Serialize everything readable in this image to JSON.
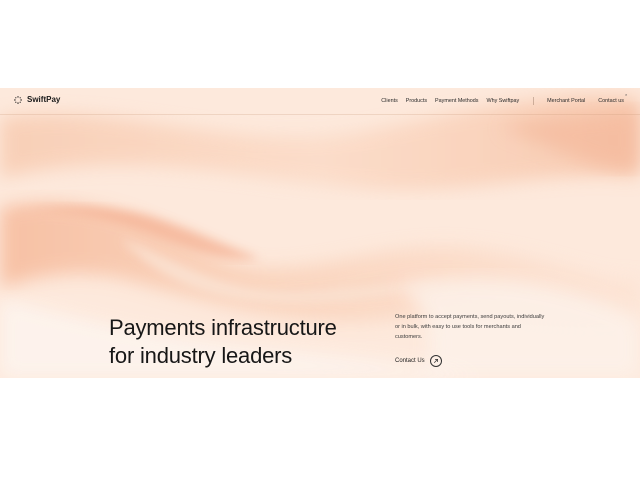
{
  "brand": {
    "name": "SwiftPay",
    "logo_icon": "dotted-burst-icon"
  },
  "nav": {
    "links": [
      "Clients",
      "Products",
      "Payment Methods",
      "Why Swiftpay"
    ],
    "merchant_portal": "Merchant Portal",
    "contact": "Contact us",
    "close_mark": "×"
  },
  "hero": {
    "headline_line1": "Payments infrastructure",
    "headline_line2": "for industry leaders",
    "description": "One platform to accept payments, send payouts, individually or in bulk, with easy to use tools for merchants and customers.",
    "cta_label": "Contact Us",
    "cta_icon": "arrow-up-right-icon",
    "colors": {
      "peach_light": "#fde8da",
      "peach_mid": "#f8c9ae",
      "peach_deep": "#f2a98a"
    }
  }
}
